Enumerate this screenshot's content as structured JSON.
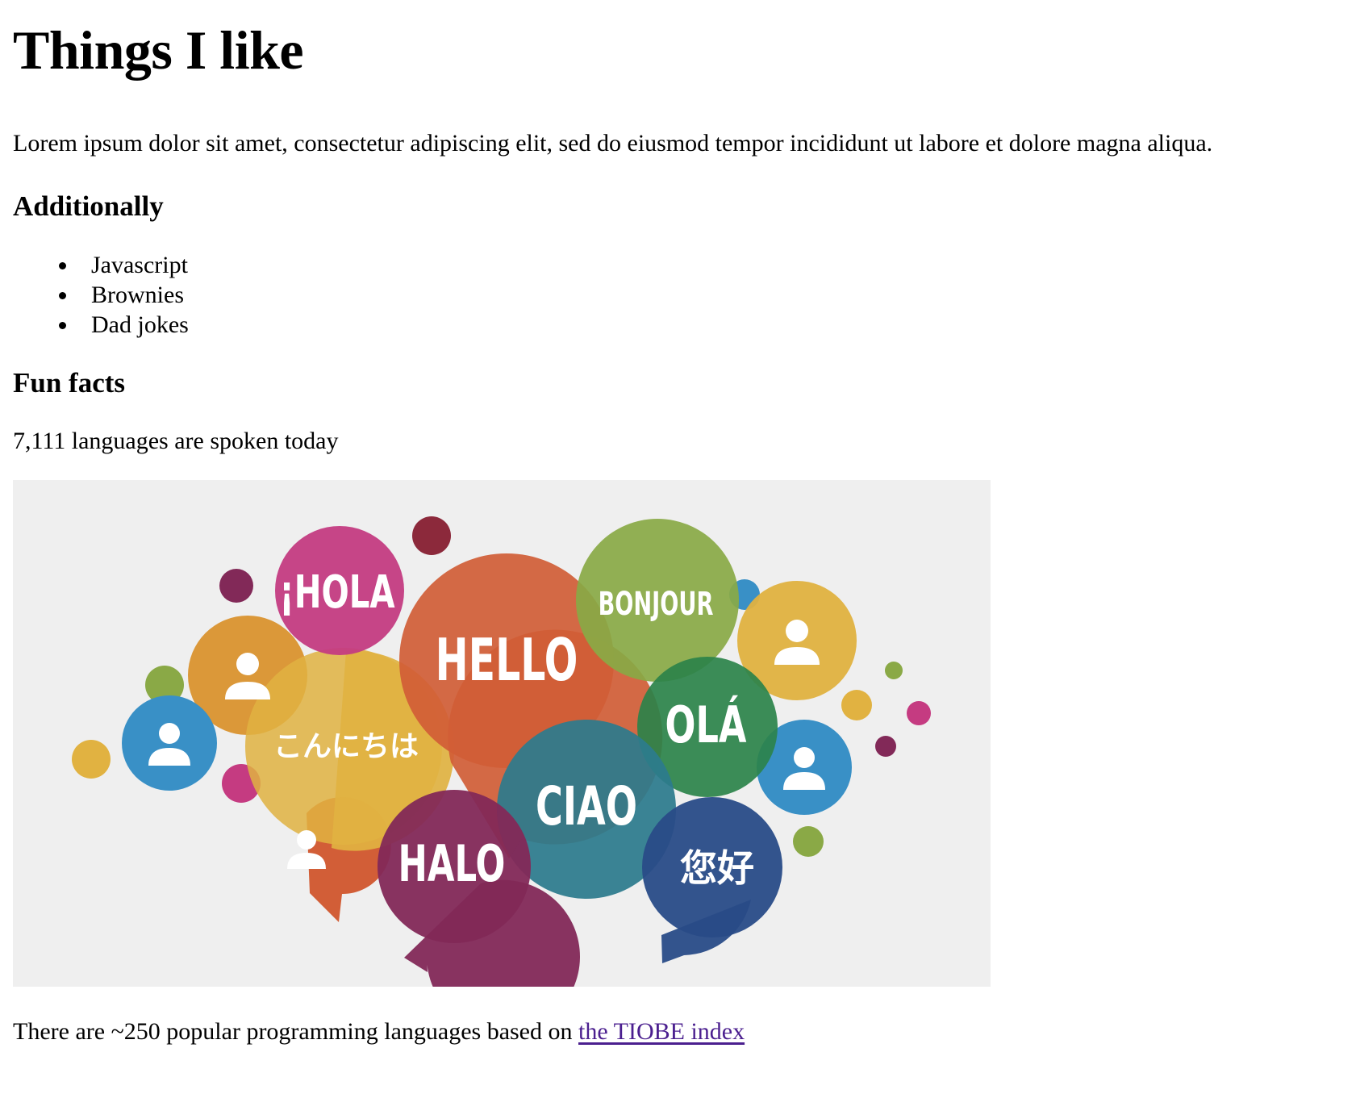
{
  "page": {
    "title": "Things I like",
    "intro": "Lorem ipsum dolor sit amet, consectetur adipiscing elit, sed do eiusmod tempor incididunt ut labore et dolore magna aliqua.",
    "additionally_heading": "Additionally",
    "likes": [
      "Javascript",
      "Brownies",
      "Dad jokes"
    ],
    "fun_facts_heading": "Fun facts",
    "fact1": "7,111 languages are spoken today",
    "fact2_prefix": "There are ~250 popular programming languages based on ",
    "fact2_link": "the TIOBE index"
  },
  "illustration": {
    "greetings": {
      "hola": "¡HOLA",
      "hello": "HELLO",
      "bonjour": "BONJOUR",
      "ola": "OLÁ",
      "konnichiwa": "こんにちは",
      "ciao": "CIAO",
      "halo": "HALO",
      "nihao": "您好"
    },
    "colors": {
      "background": "#efefef",
      "pink": "#d23f8a",
      "orange": "#e0643a",
      "lime": "#93b54a",
      "amber": "#eaa23c",
      "yellow": "#f0be45",
      "blue": "#3d9ad4",
      "green": "#2f8c4f",
      "teal": "#2f8397",
      "plum": "#8b2b5e",
      "navy": "#2b5090",
      "maroon": "#8f2035"
    },
    "icons": [
      "person-icon",
      "person-icon",
      "person-icon",
      "person-icon",
      "person-icon"
    ]
  }
}
